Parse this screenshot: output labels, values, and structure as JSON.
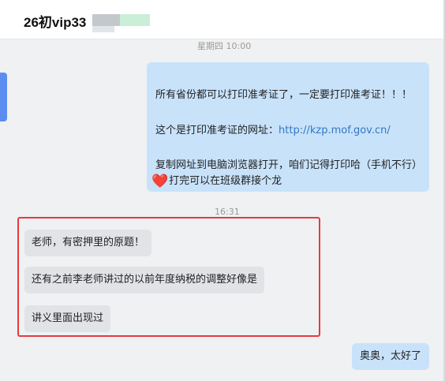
{
  "chat": {
    "title": "26初vip33"
  },
  "messages": {
    "time_1": "星期四 10:00",
    "announcement": {
      "line1": "所有省份都可以打印准考证了，一定要打印准考证！！！",
      "line2_prefix": "这个是打印准考证的网址：",
      "line2_link": "http://kzp.mof.gov.cn/",
      "line3": "复制网址到电脑浏览器打开，咱们记得打印哈（手机不行）",
      "line4_emoji": "❤️",
      "line4_text": "打完可以在班级群接个龙"
    },
    "time_2": "16:31",
    "incoming": [
      "老师，有密押里的原题！",
      "还有之前李老师讲过的以前年度纳税的调整好像是",
      "讲义里面出现过"
    ],
    "reply": "奥奥，太好了"
  },
  "colors": {
    "outgoing_bubble": "#c8e2fa",
    "incoming_bubble": "#e1e3e6",
    "highlight_border": "#e8393d",
    "link": "#2f78c4"
  }
}
